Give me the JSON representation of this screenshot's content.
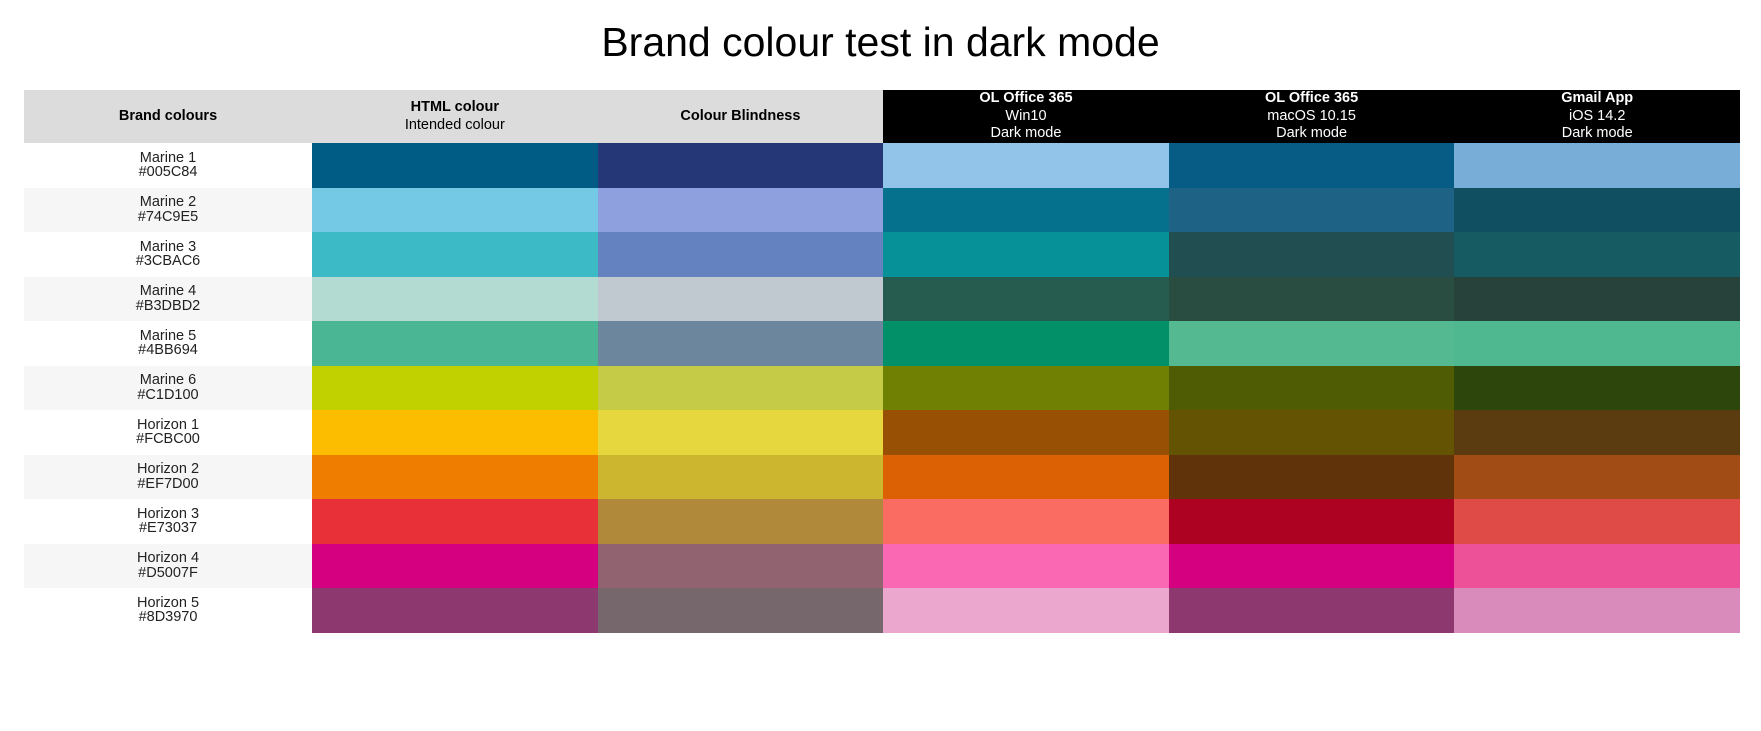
{
  "title": "Brand colour test in dark mode",
  "columns": [
    {
      "id": "brand",
      "main": "Brand colours",
      "sub": "",
      "sub2": "",
      "style": "light"
    },
    {
      "id": "html",
      "main": "HTML colour",
      "sub": "Intended colour",
      "sub2": "",
      "style": "light"
    },
    {
      "id": "blindness",
      "main": "Colour Blindness",
      "sub": "",
      "sub2": "",
      "style": "light"
    },
    {
      "id": "ol-win10",
      "main": "OL Office 365",
      "sub": "Win10",
      "sub2": "Dark mode",
      "style": "dark"
    },
    {
      "id": "ol-macos",
      "main": "OL Office 365",
      "sub": "macOS 10.15",
      "sub2": "Dark mode",
      "style": "dark"
    },
    {
      "id": "gmail-ios",
      "main": "Gmail App",
      "sub": "iOS 14.2",
      "sub2": "Dark mode",
      "style": "dark"
    }
  ],
  "rows": [
    {
      "name": "Marine 1",
      "hex": "#005C84",
      "swatches": [
        "#005C84",
        "#253777",
        "#92C3E9",
        "#075C86",
        "#77ADD6"
      ]
    },
    {
      "name": "Marine 2",
      "hex": "#74C9E5",
      "swatches": [
        "#74C9E5",
        "#8FA0DE",
        "#06718D",
        "#1E6386",
        "#104E61"
      ]
    },
    {
      "name": "Marine 3",
      "hex": "#3CBAC6",
      "swatches": [
        "#3CBAC6",
        "#6582C0",
        "#069097",
        "#214F51",
        "#175B62"
      ]
    },
    {
      "name": "Marine 4",
      "hex": "#B3DBD2",
      "swatches": [
        "#B3DBD2",
        "#C0C8D0",
        "#265C4F",
        "#2A4D41",
        "#27423A"
      ]
    },
    {
      "name": "Marine 5",
      "hex": "#4BB694",
      "swatches": [
        "#4BB694",
        "#6B869D",
        "#029069",
        "#54B891",
        "#50B891"
      ]
    },
    {
      "name": "Marine 6",
      "hex": "#C1D100",
      "swatches": [
        "#C1D100",
        "#C5CB46",
        "#708002",
        "#4F5C03",
        "#2D460B"
      ]
    },
    {
      "name": "Horizon 1",
      "hex": "#FCBC00",
      "swatches": [
        "#FCBC00",
        "#E7D73F",
        "#975004",
        "#655304",
        "#5B3C10"
      ]
    },
    {
      "name": "Horizon 2",
      "hex": "#EF7D00",
      "swatches": [
        "#EF7D00",
        "#CCB52F",
        "#DC6004",
        "#60330A",
        "#A14C15"
      ]
    },
    {
      "name": "Horizon 3",
      "hex": "#E73037",
      "swatches": [
        "#E73037",
        "#B1893A",
        "#FA6C61",
        "#AD0221",
        "#DF4B46"
      ]
    },
    {
      "name": "Horizon 4",
      "hex": "#D5007F",
      "swatches": [
        "#D5007F",
        "#91626F",
        "#FA68B4",
        "#D5007F",
        "#ED5197"
      ]
    },
    {
      "name": "Horizon 5",
      "hex": "#8D3970",
      "swatches": [
        "#8D3970",
        "#75676C",
        "#ECA7CE",
        "#8D3970",
        "#D98CBB"
      ]
    }
  ]
}
